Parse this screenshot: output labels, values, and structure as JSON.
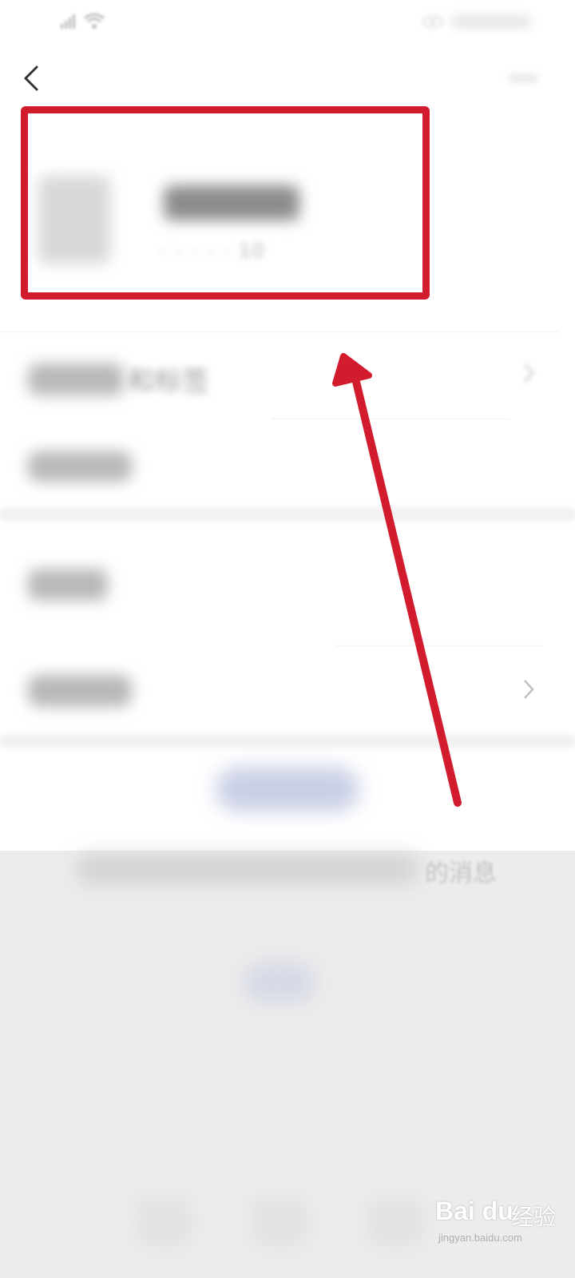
{
  "status_bar": {
    "signal_icon": "signal-icon",
    "wifi_icon": "wifi-icon",
    "eye_icon": "eye-icon"
  },
  "header": {
    "back_icon": "chevron-left-icon",
    "more_icon": "more-dots-icon"
  },
  "profile": {
    "id_text_fragment": "10"
  },
  "settings_rows": [
    {
      "label_fragment": "和标签",
      "has_chevron": true
    },
    {
      "label_fragment": "",
      "has_chevron": false
    },
    {
      "label_fragment": "",
      "has_chevron": false
    },
    {
      "label_fragment": "",
      "has_chevron": true
    }
  ],
  "messages": {
    "tail_text": "的消息"
  },
  "annotation": {
    "color": "#d21c2e",
    "highlight_target": "profile-card",
    "arrow_points_to": "profile-card"
  },
  "watermark": {
    "brand": "Bai du",
    "sub": "经验",
    "url": "jingyan.baidu.com"
  }
}
